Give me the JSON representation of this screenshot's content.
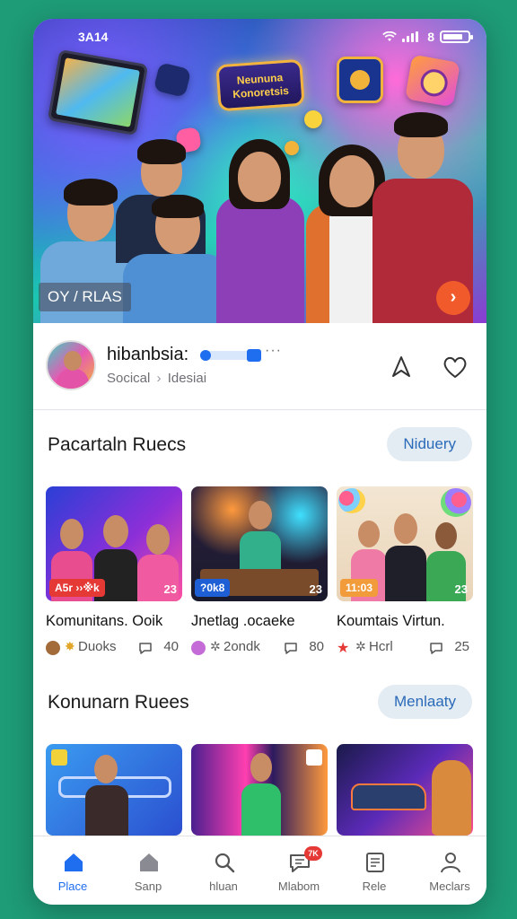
{
  "status_bar": {
    "time": "3A14",
    "network": " 8"
  },
  "hero": {
    "sign_text": "Neununa Konoretsis",
    "label": "OY / RLAS",
    "next_icon": "arrow-right-icon"
  },
  "profile": {
    "name": "hibanbsia:",
    "more": "···",
    "category": "Socical",
    "subcategory": "Idesiai"
  },
  "sections": [
    {
      "title": "Pacartaln Ruecs",
      "pill": "Niduery",
      "cards": [
        {
          "title": "Komunitans. Ooik",
          "tag_left": "A5r ››※k",
          "tag_right": "23",
          "meta_name": "Duoks",
          "meta_count": "40",
          "tag_color": "#e53935",
          "dot_color": "#a36b3a"
        },
        {
          "title": "Jnetlag .ocaeke",
          "tag_left": "?0k8",
          "tag_right": "23",
          "meta_name": "2ondk",
          "meta_count": "80",
          "tag_color": "#1f5fd6",
          "dot_color": "#c46bd8"
        },
        {
          "title": "Koumtais Virtun.",
          "tag_left": "11:03",
          "tag_right": "23",
          "meta_name": "Hcrl",
          "meta_count": "25",
          "tag_color": "#f29b3a",
          "dot_color": "#e53935"
        }
      ]
    },
    {
      "title": "Konunarn Ruees",
      "pill": "Menlaaty"
    }
  ],
  "tabbar": [
    {
      "label": "Place",
      "icon": "home-filled-icon",
      "active": true
    },
    {
      "label": "Sanp",
      "icon": "home-outline-icon",
      "active": false
    },
    {
      "label": "hluan",
      "icon": "search-icon",
      "active": false
    },
    {
      "label": "Mlabom",
      "icon": "chat-icon",
      "active": false,
      "badge": "7K"
    },
    {
      "label": "Rele",
      "icon": "list-icon",
      "active": false
    },
    {
      "label": "Meclars",
      "icon": "person-icon",
      "active": false
    }
  ],
  "colors": {
    "accent": "#1f6ef0",
    "background": "#1e9b77",
    "hero_button": "#f15a2b"
  }
}
